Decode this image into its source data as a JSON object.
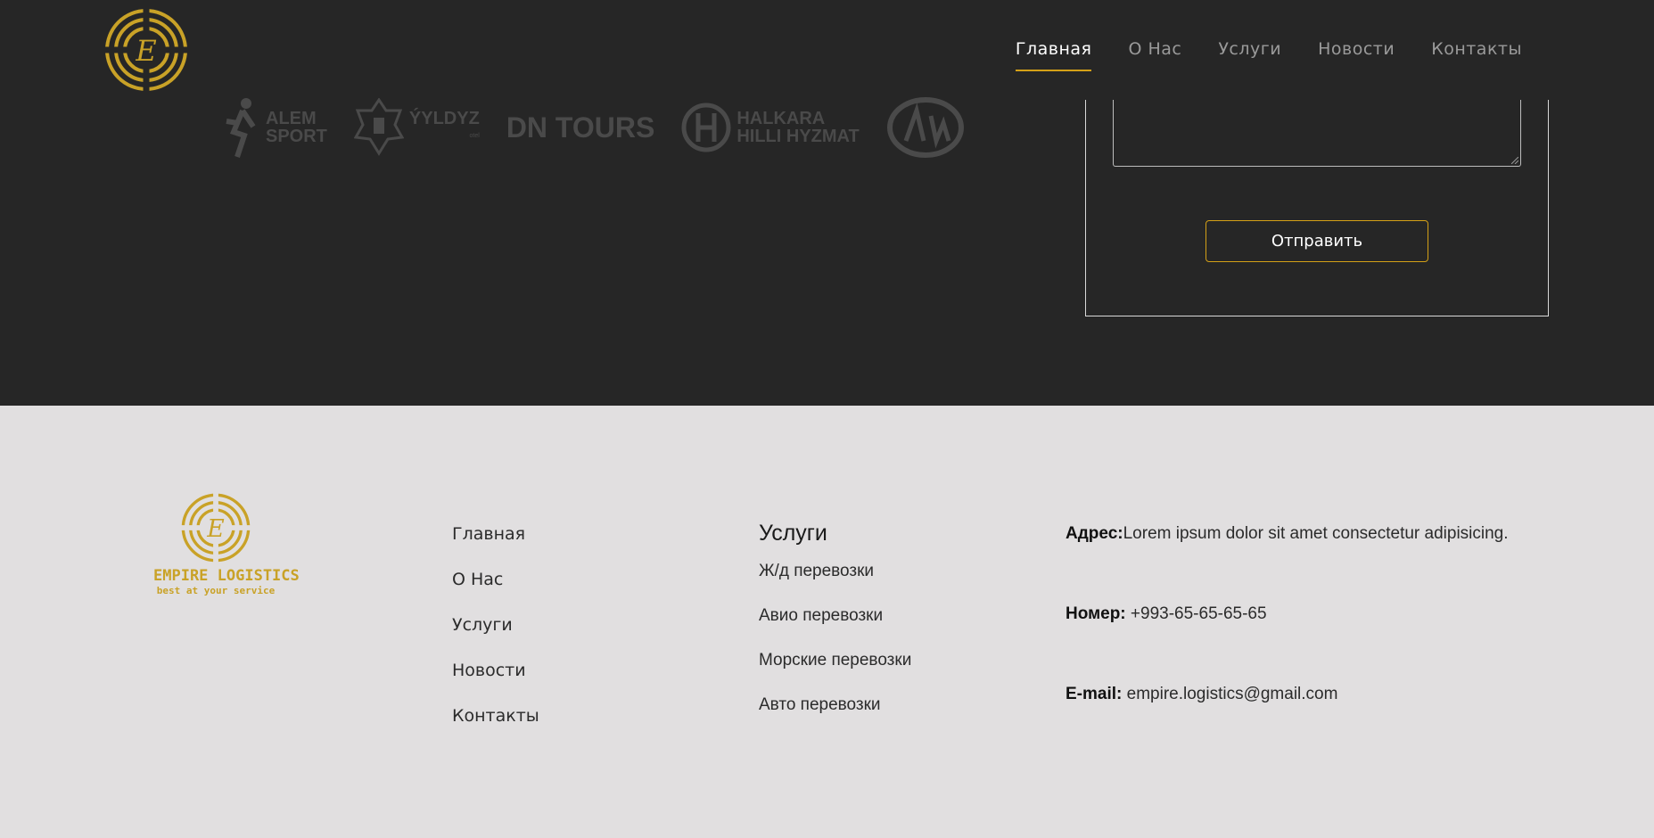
{
  "colors": {
    "accent": "#d4a017",
    "dark_bg": "#262626",
    "footer_bg": "#e1dfe0",
    "logo_gold": "#c9a227"
  },
  "nav": {
    "items": [
      {
        "label": "Главная",
        "active": true
      },
      {
        "label": "О Нас"
      },
      {
        "label": "Услуги"
      },
      {
        "label": "Новости"
      },
      {
        "label": "Контакты"
      }
    ]
  },
  "partners": [
    {
      "name": "ALEM SPORT",
      "line1": "ALEM",
      "line2": "SPORT"
    },
    {
      "name": "ÝYLDYZ otel",
      "line1": "ÝYLDYZ",
      "line2": "otel"
    },
    {
      "name": "DN TOURS",
      "line1": "DN TOURS",
      "line2": ""
    },
    {
      "name": "HALKARA HILLI HYZMAT",
      "line1": "HALKARA",
      "line2": "HILLI HYZMAT"
    },
    {
      "name": "AW",
      "line1": "",
      "line2": ""
    }
  ],
  "form": {
    "submit_label": "Отправить"
  },
  "footer": {
    "brand": {
      "name": "EMPIRE LOGISTICS",
      "tagline": "best at your service"
    },
    "links": [
      "Главная",
      "О Нас",
      "Услуги",
      "Новости",
      "Контакты"
    ],
    "services": {
      "heading": "Услуги",
      "items": [
        "Ж/д перевозки",
        "Авио перевозки",
        "Морские перевозки",
        "Авто перевозки"
      ]
    },
    "contact": {
      "address_label": "Адрес:",
      "address": "Lorem ipsum dolor sit amet consectetur adipisicing.",
      "phone_label": "Номер:",
      "phone": "+993-65-65-65-65",
      "email_label": "E-mail:",
      "email": "empire.logistics@gmail.com"
    }
  }
}
